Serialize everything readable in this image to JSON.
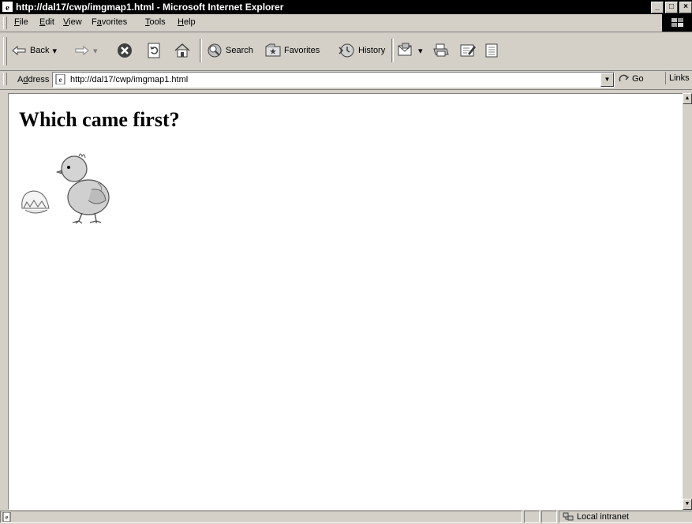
{
  "window": {
    "title": "http://dal17/cwp/imgmap1.html - Microsoft Internet Explorer"
  },
  "window_controls": {
    "minimize": "_",
    "maximize": "□",
    "close": "×"
  },
  "menu": {
    "items": [
      {
        "label": "File",
        "accel": "F",
        "rest": "ile"
      },
      {
        "label": "Edit",
        "accel": "E",
        "rest": "dit"
      },
      {
        "label": "View",
        "accel": "V",
        "rest": "iew"
      },
      {
        "label": "Favorites",
        "pre": "F",
        "accel": "a",
        "rest": "vorites"
      },
      {
        "label": "Tools",
        "accel": "T",
        "rest": "ools"
      },
      {
        "label": "Help",
        "accel": "H",
        "rest": "elp"
      }
    ]
  },
  "toolbar": {
    "back": "Back",
    "search": "Search",
    "favorites": "Favorites",
    "history": "History"
  },
  "address": {
    "label_accel": "d",
    "label_pre": "A",
    "label_rest": "dress",
    "url": "http://dal17/cwp/imgmap1.html",
    "go": "Go",
    "links": "Links"
  },
  "page": {
    "heading": "Which came first?",
    "image_subject": "egg-and-chick"
  },
  "status": {
    "zone": "Local intranet"
  },
  "icons": [
    "ie-page-icon",
    "back-arrow-icon",
    "forward-arrow-icon",
    "stop-icon",
    "refresh-icon",
    "home-icon",
    "search-icon",
    "favorites-icon",
    "history-icon",
    "mail-icon",
    "print-icon",
    "edit-icon",
    "discuss-icon",
    "go-arrow-icon",
    "intranet-icon"
  ],
  "colors": {
    "titlebar": "#000000",
    "chrome": "#d4d0c8",
    "content": "#ffffff"
  }
}
